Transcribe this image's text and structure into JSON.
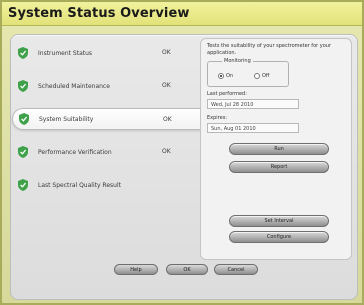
{
  "window": {
    "title": "System Status Overview"
  },
  "list": {
    "items": [
      {
        "label": "Instrument Status",
        "status": "OK"
      },
      {
        "label": "Scheduled Maintenance",
        "status": "OK"
      },
      {
        "label": "System Suitability",
        "status": "OK"
      },
      {
        "label": "Performance Verification",
        "status": "OK"
      },
      {
        "label": "Last Spectral Quality Result",
        "status": ""
      }
    ]
  },
  "panel": {
    "description": "Tests the suitability of your spectrometer for your application.",
    "monitoring": {
      "label": "Monitoring",
      "on_label": "On",
      "off_label": "Off"
    },
    "last_performed": {
      "label": "Last performed:",
      "value": "Wed, Jul 28 2010"
    },
    "expires": {
      "label": "Expires:",
      "value": "Sun, Aug 01 2010"
    },
    "buttons": {
      "run": "Run",
      "report": "Report",
      "set_interval": "Set Interval",
      "configure": "Configure"
    }
  },
  "footer": {
    "help": "Help",
    "ok": "OK",
    "cancel": "Cancel"
  },
  "colors": {
    "shield": "#3fa14a",
    "title_bar": "#e2e27a",
    "frame": "#d6d99a"
  }
}
